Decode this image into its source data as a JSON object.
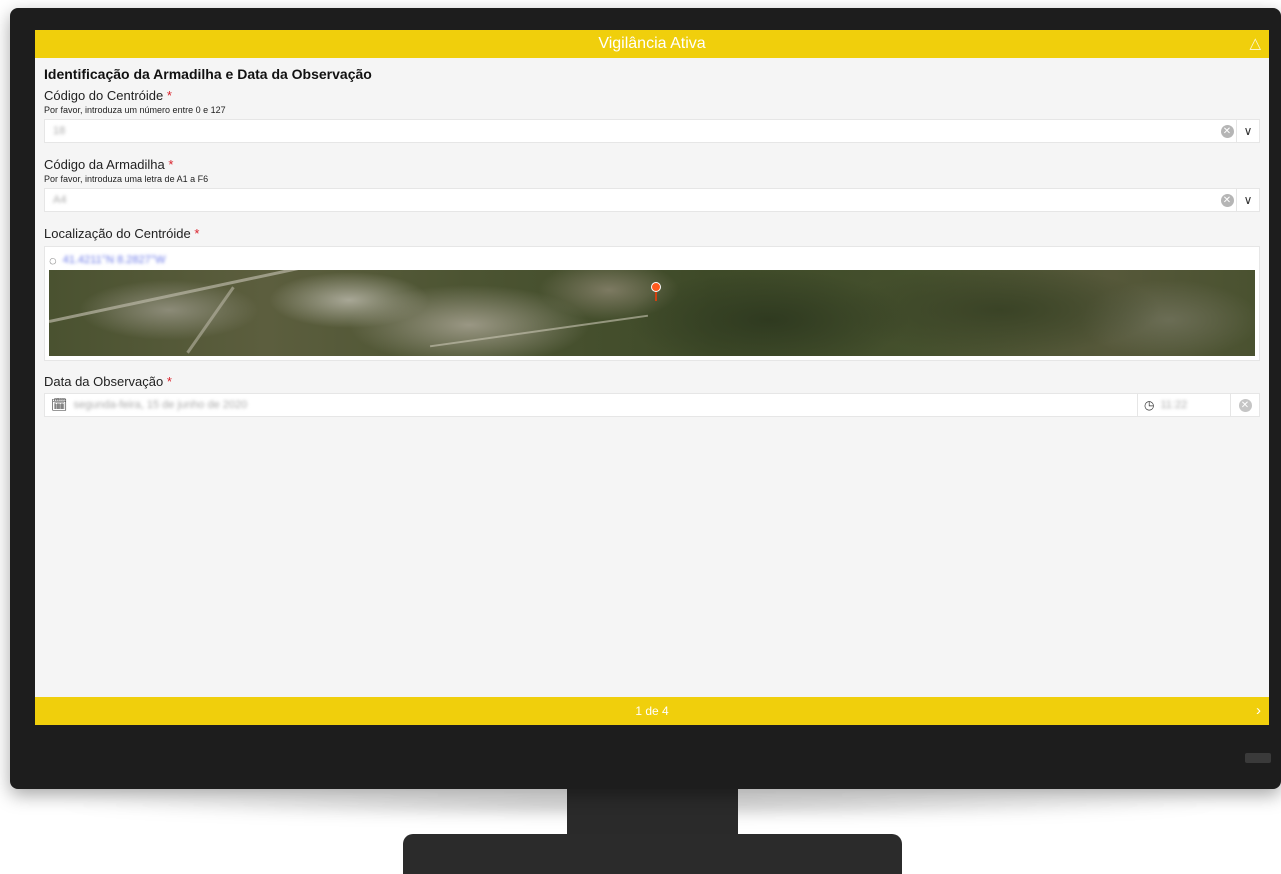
{
  "header": {
    "title": "Vigilância Ativa",
    "collapse_icon": "chevron-up-icon"
  },
  "section": {
    "title": "Identificação da Armadilha e Data da Observação"
  },
  "fields": {
    "centroid_code": {
      "label": "Código do Centróide",
      "required_mark": "*",
      "hint": "Por favor, introduza um número entre 0 e 127",
      "value": "18"
    },
    "trap_code": {
      "label": "Código da Armadilha",
      "required_mark": "*",
      "hint": "Por favor, introduza uma letra de A1 a F6",
      "value": "A4"
    },
    "centroid_location": {
      "label": "Localização do Centróide",
      "required_mark": "*",
      "coordinates": "41.4211°N 8.2827°W"
    },
    "observation_date": {
      "label": "Data da Observação",
      "required_mark": "*",
      "date": "segunda-feira, 15 de junho de 2020",
      "time": "11:22"
    }
  },
  "footer": {
    "page_indicator": "1 de 4",
    "next_icon": "chevron-right-icon"
  },
  "colors": {
    "accent": "#f0cf0c",
    "required": "#d9202a",
    "background": "#f5f5f5"
  }
}
